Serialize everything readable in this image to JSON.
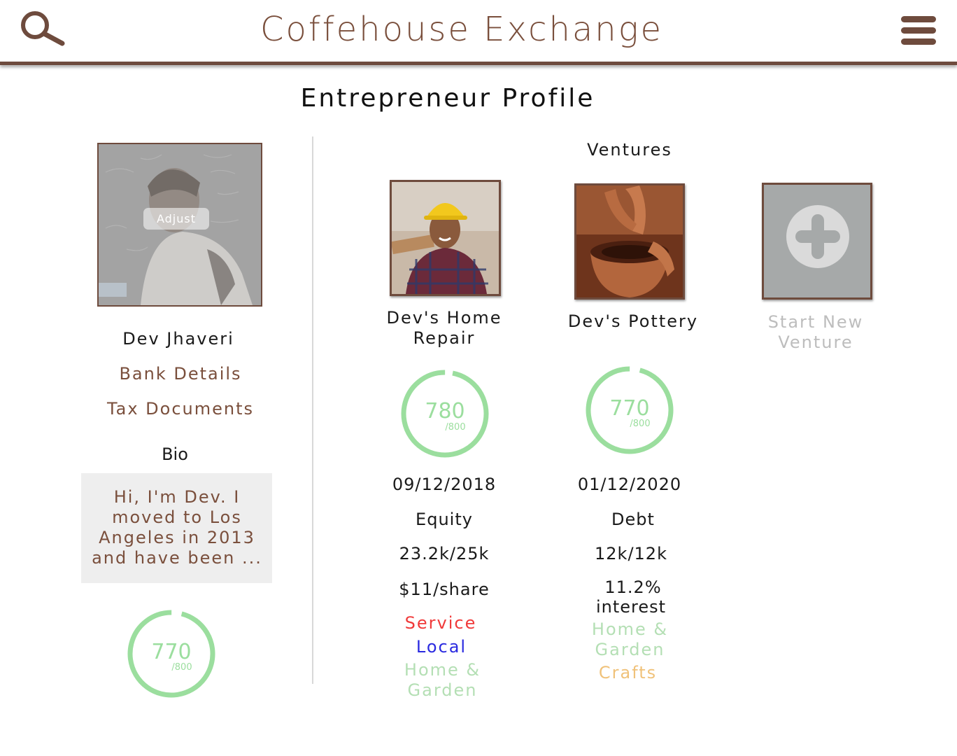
{
  "header": {
    "title": "Coffehouse Exchange",
    "search_icon": "search-icon",
    "menu_icon": "hamburger-menu-icon"
  },
  "page_title": "Entrepreneur Profile",
  "profile": {
    "adjust_label": "Adjust",
    "name": "Dev Jhaveri",
    "bank_link": "Bank Details",
    "tax_link": "Tax Documents",
    "bio_label": "Bio",
    "bio_text": "Hi, I'm Dev. I moved to Los Angeles in 2013 and have been ...",
    "score": {
      "value": "770",
      "max": "/800",
      "fill_fraction": 0.96
    }
  },
  "ventures": {
    "label": "Ventures",
    "items": [
      {
        "name_line1": "Dev's Home",
        "name_line2": "Repair",
        "score": {
          "value": "780",
          "max": "/800",
          "fill_fraction": 0.97
        },
        "date": "09/12/2018",
        "type": "Equity",
        "raised": "23.2k/25k",
        "terms_line1": "$11/share",
        "terms_line2": "",
        "tags": [
          {
            "label": "Service",
            "color": "#f03a3a"
          },
          {
            "label": "Local",
            "color": "#2a2ae0"
          },
          {
            "label": "Home & Garden",
            "color": "#b4dfb4"
          }
        ]
      },
      {
        "name_line1": "Dev's Pottery",
        "name_line2": "",
        "score": {
          "value": "770",
          "max": "/800",
          "fill_fraction": 0.96
        },
        "date": "01/12/2020",
        "type": "Debt",
        "raised": "12k/12k",
        "terms_line1": "11.2%",
        "terms_line2": "interest",
        "tags": [
          {
            "label": "Home & Garden",
            "color": "#b4dfb4"
          },
          {
            "label": "Crafts",
            "color": "#f0c27a"
          }
        ]
      }
    ],
    "new_venture_line1": "Start New",
    "new_venture_line2": "Venture"
  },
  "colors": {
    "brand_brown": "#6e4b3d",
    "link_brown": "#7a4f3c",
    "score_green": "#9bde9e",
    "tile_grey": "#a6a9a9",
    "muted_text": "#bdbdbd"
  }
}
